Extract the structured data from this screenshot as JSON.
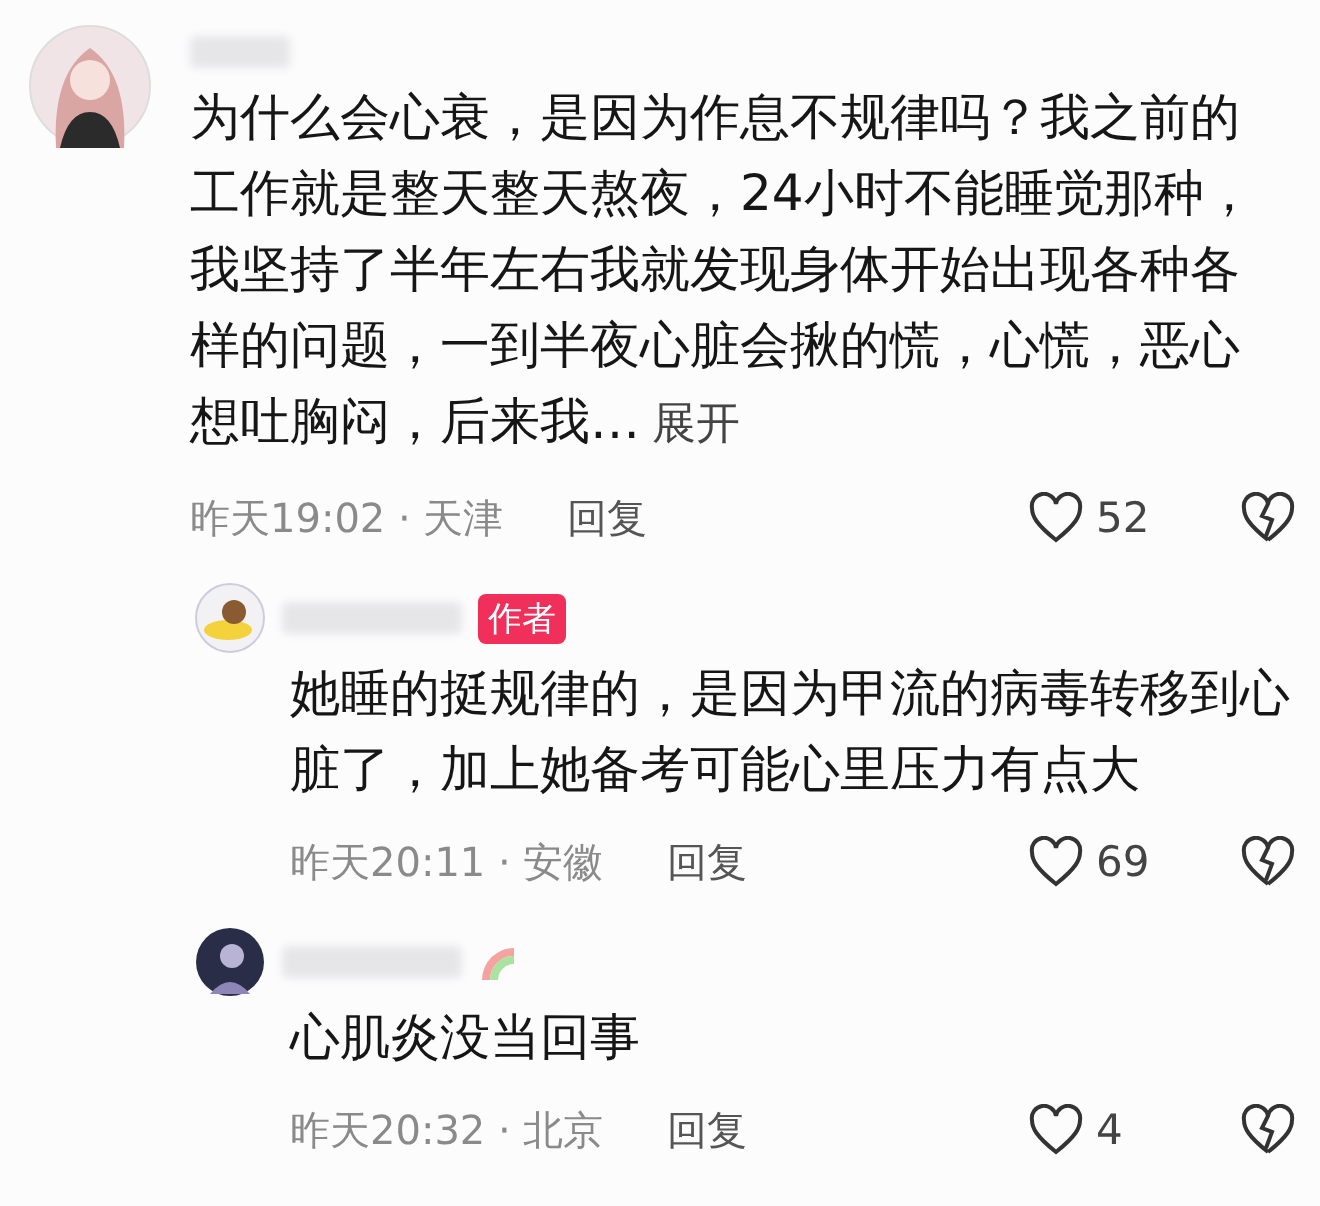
{
  "comments": [
    {
      "kind": "comment",
      "text": "为什么会心衰，是因为作息不规律吗？我之前的工作就是整天整天熬夜，24小时不能睡觉那种，我坚持了半年左右我就发现身体开始出现各种各样的问题，一到半夜心脏会揪的慌，心慌，恶心想吐胸闷，后来我…",
      "expand": "展开",
      "meta": "昨天19:02 · 天津",
      "reply": "回复",
      "likes": "52"
    },
    {
      "kind": "reply",
      "badge": "作者",
      "text": "她睡的挺规律的，是因为甲流的病毒转移到心脏了，加上她备考可能心里压力有点大",
      "meta": "昨天20:11 · 安徽",
      "reply": "回复",
      "likes": "69"
    },
    {
      "kind": "reply",
      "rainbow": true,
      "text": "心肌炎没当回事",
      "meta": "昨天20:32 · 北京",
      "reply": "回复",
      "likes": "4"
    }
  ]
}
